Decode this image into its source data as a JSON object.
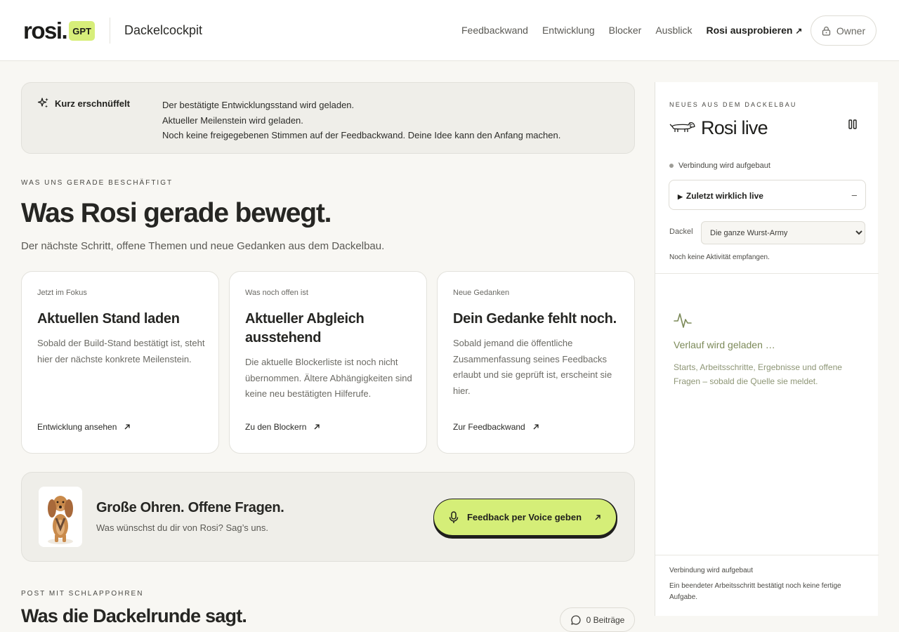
{
  "header": {
    "logo_word": "rosi.",
    "logo_badge": "GPT",
    "app_title": "Dackelcockpit",
    "nav": [
      "Feedbackwand",
      "Entwicklung",
      "Blocker",
      "Ausblick"
    ],
    "cta": "Rosi ausprobieren",
    "cta_icon": "arrow-up-right-icon",
    "owner": "Owner",
    "owner_icon": "lock-icon"
  },
  "notice": {
    "icon": "sparkle-icon",
    "title": "Kurz erschnüffelt",
    "lines": [
      "Der bestätigte Entwicklungsstand wird geladen.",
      "Aktueller Meilenstein wird geladen.",
      "Noch keine freigegebenen Stimmen auf der Feedbackwand. Deine Idee kann den Anfang machen."
    ]
  },
  "section": {
    "eyebrow": "WAS UNS GERADE BESCHÄFTIGT",
    "title": "Was Rosi gerade bewegt.",
    "lead": "Der nächste Schritt, offene Themen und neue Gedanken aus dem Dackelbau."
  },
  "cards": [
    {
      "label": "Jetzt im Fokus",
      "title": "Aktuellen Stand laden",
      "text": "Sobald der Build-Stand bestätigt ist, steht hier der nächste konkrete Meilenstein.",
      "link": "Entwicklung ansehen"
    },
    {
      "label": "Was noch offen ist",
      "title": "Aktueller Abgleich ausstehend",
      "text": "Die aktuelle Blockerliste ist noch nicht übernommen. Ältere Abhängigkeiten sind keine neu bestätigten Hilferufe.",
      "link": "Zu den Blockern"
    },
    {
      "label": "Neue Gedanken",
      "title": "Dein Gedanke fehlt noch.",
      "text": "Sobald jemand die öffentliche Zusammenfassung seines Feedbacks erlaubt und sie geprüft ist, erscheint sie hier.",
      "link": "Zur Feedbackwand"
    }
  ],
  "voice": {
    "title": "Große Ohren. Offene Fragen.",
    "subtitle": "Was wünschst du dir von Rosi? Sag’s uns.",
    "button": "Feedback per Voice geben",
    "button_icon": "microphone-icon"
  },
  "post": {
    "eyebrow": "POST MIT SCHLAPPOHREN",
    "title": "Was die Dackelrunde sagt.",
    "count": "0 Beiträge",
    "count_icon": "speech-bubble-icon"
  },
  "panel": {
    "eyebrow": "NEUES AUS DEM DACKELBAU",
    "title": "Rosi live",
    "status": "Verbindung wird aufgebaut",
    "recent_label": "Zuletzt wirklich live",
    "recent_collapse": "–",
    "dackel_label": "Dackel",
    "dackel_selected": "Die ganze Wurst-Army",
    "no_activity": "Noch keine Aktivität empfangen.",
    "loading_title": "Verlauf wird geladen …",
    "loading_text": "Starts, Arbeitsschritte, Ergebnisse und offene Fragen – sobald die Quelle sie meldet.",
    "footer_status": "Verbindung wird aufgebaut",
    "footer_note": "Ein beendeter Arbeitsschritt bestätigt noch keine fertige Aufgabe."
  },
  "colors": {
    "accent_lime": "#d7ee7a",
    "background": "#f8f7f3",
    "muted_green": "#7c8a59"
  }
}
